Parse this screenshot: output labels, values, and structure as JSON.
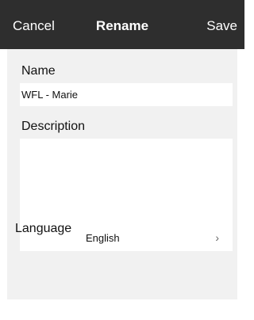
{
  "navbar": {
    "cancel_label": "Cancel",
    "title": "Rename",
    "save_label": "Save"
  },
  "form": {
    "name": {
      "label": "Name",
      "value": "WFL - Marie"
    },
    "description": {
      "label": "Description",
      "value": ""
    },
    "language": {
      "label": "Language",
      "selected": "English",
      "chevron": "›"
    }
  },
  "colors": {
    "navbar_bg": "#2e2e2e",
    "content_bg": "#f1f1f1",
    "field_bg": "#ffffff"
  }
}
